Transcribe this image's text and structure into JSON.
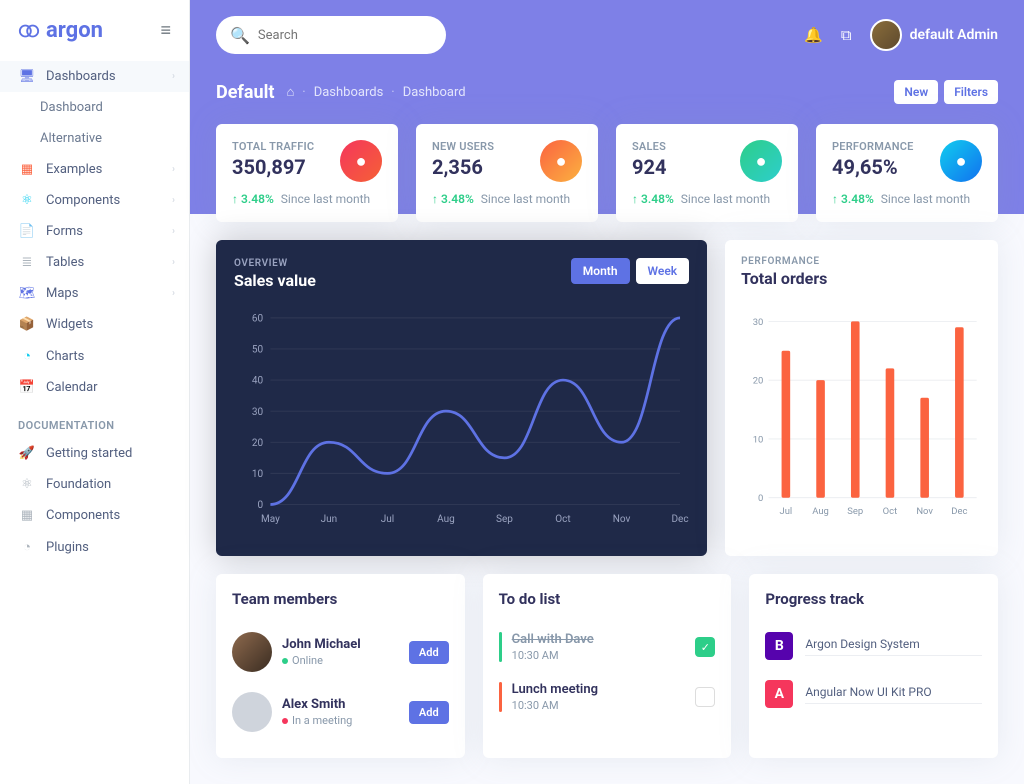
{
  "brand": "argon",
  "search": {
    "placeholder": "Search"
  },
  "user": {
    "name": "default Admin"
  },
  "nav": {
    "main": [
      {
        "label": "Dashboards",
        "icon": "tv",
        "color": "i-blue",
        "expand": true
      },
      {
        "label": "Dashboard",
        "sub": true
      },
      {
        "label": "Alternative",
        "sub": true
      },
      {
        "label": "Examples",
        "icon": "grid",
        "color": "i-orange",
        "expand": true
      },
      {
        "label": "Components",
        "icon": "atom",
        "color": "i-teal",
        "expand": true
      },
      {
        "label": "Forms",
        "icon": "file",
        "color": "i-pink",
        "expand": true
      },
      {
        "label": "Tables",
        "icon": "list",
        "color": "",
        "expand": true
      },
      {
        "label": "Maps",
        "icon": "map",
        "color": "i-blue",
        "expand": true
      },
      {
        "label": "Widgets",
        "icon": "box",
        "color": "i-green"
      },
      {
        "label": "Charts",
        "icon": "pie",
        "color": "i-teal"
      },
      {
        "label": "Calendar",
        "icon": "cal",
        "color": "i-red"
      }
    ],
    "doc_header": "DOCUMENTATION",
    "docs": [
      {
        "label": "Getting started",
        "icon": "rocket"
      },
      {
        "label": "Foundation",
        "icon": "atom"
      },
      {
        "label": "Components",
        "icon": "grid"
      },
      {
        "label": "Plugins",
        "icon": "pie"
      }
    ]
  },
  "page": {
    "title": "Default",
    "crumbs": [
      "Dashboards",
      "Dashboard"
    ],
    "actions": {
      "new": "New",
      "filters": "Filters"
    }
  },
  "stats": [
    {
      "label": "TOTAL TRAFFIC",
      "value": "350,897",
      "delta": "3.48%",
      "since": "Since last month",
      "grad": "grad-red"
    },
    {
      "label": "NEW USERS",
      "value": "2,356",
      "delta": "3.48%",
      "since": "Since last month",
      "grad": "grad-orange"
    },
    {
      "label": "SALES",
      "value": "924",
      "delta": "3.48%",
      "since": "Since last month",
      "grad": "grad-green"
    },
    {
      "label": "PERFORMANCE",
      "value": "49,65%",
      "delta": "3.48%",
      "since": "Since last month",
      "grad": "grad-blue"
    }
  ],
  "sales": {
    "pre": "OVERVIEW",
    "title": "Sales value",
    "toggle": {
      "month": "Month",
      "week": "Week"
    }
  },
  "orders": {
    "pre": "PERFORMANCE",
    "title": "Total orders"
  },
  "chart_data": [
    {
      "type": "line",
      "title": "Sales value",
      "categories": [
        "May",
        "Jun",
        "Jul",
        "Aug",
        "Sep",
        "Oct",
        "Nov",
        "Dec"
      ],
      "values": [
        0,
        20,
        10,
        30,
        15,
        40,
        20,
        60
      ],
      "ylim": [
        0,
        60
      ],
      "yticks": [
        0,
        10,
        20,
        30,
        40,
        50,
        60
      ]
    },
    {
      "type": "bar",
      "title": "Total orders",
      "categories": [
        "Jul",
        "Aug",
        "Sep",
        "Oct",
        "Nov",
        "Dec"
      ],
      "values": [
        25,
        20,
        30,
        22,
        17,
        29
      ],
      "ylim": [
        0,
        30
      ],
      "yticks": [
        0,
        10,
        20,
        30
      ]
    }
  ],
  "team": {
    "title": "Team members",
    "add": "Add",
    "members": [
      {
        "name": "John Michael",
        "status": "Online",
        "dot": "green",
        "av": "jm"
      },
      {
        "name": "Alex Smith",
        "status": "In a meeting",
        "dot": "red",
        "av": ""
      }
    ]
  },
  "todo": {
    "title": "To do list",
    "items": [
      {
        "title": "Call with Dave",
        "time": "10:30 AM",
        "done": true,
        "bar": "green"
      },
      {
        "title": "Lunch meeting",
        "time": "10:30 AM",
        "done": false,
        "bar": "orange"
      }
    ]
  },
  "progress": {
    "title": "Progress track",
    "items": [
      {
        "name": "Argon Design System",
        "badge": "B",
        "color": "#5603ad"
      },
      {
        "name": "Angular Now UI Kit PRO",
        "badge": "A",
        "color": "#f5365c"
      }
    ]
  }
}
